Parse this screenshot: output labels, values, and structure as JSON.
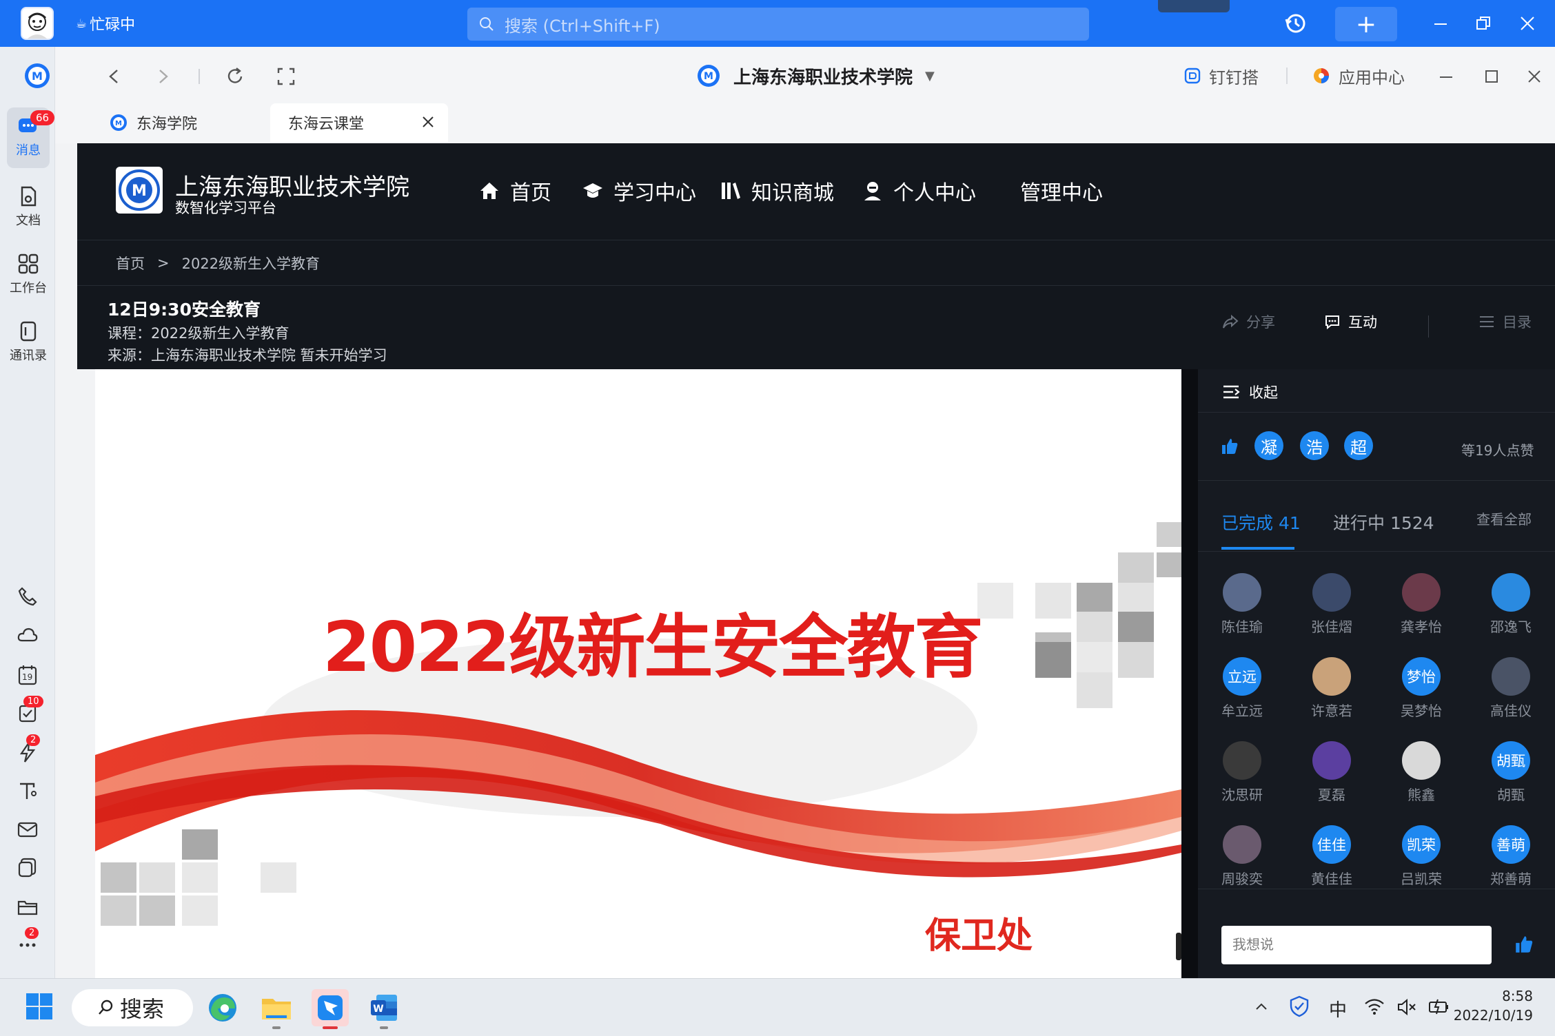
{
  "titlebar": {
    "status": "忙碌中",
    "search_placeholder": "搜索 (Ctrl+Shift+F)",
    "plus_label": "+"
  },
  "rail": {
    "items": [
      {
        "label": "消息",
        "badge": "66",
        "icon": "chat-icon"
      },
      {
        "label": "文档",
        "icon": "document-icon"
      },
      {
        "label": "工作台",
        "icon": "grid-icon"
      },
      {
        "label": "通讯录",
        "icon": "contacts-icon"
      }
    ],
    "small_icons": [
      {
        "icon": "phone-icon"
      },
      {
        "icon": "cloud-icon"
      },
      {
        "icon": "calendar-icon",
        "text": "19"
      },
      {
        "icon": "todo-icon",
        "badge": "10"
      },
      {
        "icon": "flash-icon",
        "badge": "2"
      },
      {
        "icon": "text-tool-icon"
      },
      {
        "icon": "mail-icon"
      },
      {
        "icon": "notes-icon"
      },
      {
        "icon": "folder-icon"
      },
      {
        "icon": "more-icon",
        "badge": "2"
      }
    ]
  },
  "chrome": {
    "site_title": "上海东海职业技术学院",
    "dingda": "钉钉搭",
    "app_center": "应用中心",
    "tabs": [
      {
        "label": "东海学院"
      },
      {
        "label": "东海云课堂"
      }
    ]
  },
  "site": {
    "brand_name": "上海东海职业技术学院",
    "brand_sub": "数智化学习平台",
    "nav": [
      {
        "label": "首页",
        "icon": "home-icon"
      },
      {
        "label": "学习中心",
        "icon": "graduation-cap-icon"
      },
      {
        "label": "知识商城",
        "icon": "library-icon"
      },
      {
        "label": "个人中心",
        "icon": "user-icon"
      },
      {
        "label": "管理中心",
        "icon": ""
      }
    ],
    "breadcrumb": {
      "home": "首页",
      "sep": ">",
      "current": "2022级新生入学教育"
    }
  },
  "lesson": {
    "title": "12日9:30安全教育",
    "course": "课程：2022级新生入学教育",
    "source": "来源：上海东海职业技术学院 暂未开始学习",
    "actions": {
      "share": "分享",
      "interact": "互动",
      "toc": "目录"
    }
  },
  "slide": {
    "title": "2022级新生安全教育",
    "dept": "保卫处"
  },
  "panel": {
    "collapse": "收起",
    "likers": [
      "凝",
      "浩",
      "超"
    ],
    "likes_count": "等19人点赞",
    "tab_done": "已完成 41",
    "tab_progress": "进行中 1524",
    "view_all": "查看全部",
    "students": [
      {
        "name": "陈佳瑜",
        "color": "#5a6a8c",
        "text": ""
      },
      {
        "name": "张佳熠",
        "color": "#3b4a6a",
        "text": ""
      },
      {
        "name": "龚孝怡",
        "color": "#6b3a4a",
        "text": ""
      },
      {
        "name": "邵逸飞",
        "color": "#2a8ae0",
        "text": ""
      },
      {
        "name": "牟立远",
        "color": "#1e88f0",
        "text": "立远"
      },
      {
        "name": "许意若",
        "color": "#c9a27a",
        "text": ""
      },
      {
        "name": "吴梦怡",
        "color": "#1e88f0",
        "text": "梦怡"
      },
      {
        "name": "高佳仪",
        "color": "#4a5366",
        "text": ""
      },
      {
        "name": "沈思研",
        "color": "#3a3a3a",
        "text": ""
      },
      {
        "name": "夏磊",
        "color": "#5b3fa0",
        "text": ""
      },
      {
        "name": "熊鑫",
        "color": "#d9d9d9",
        "text": ""
      },
      {
        "name": "胡甄",
        "color": "#1e88f0",
        "text": "胡甄"
      },
      {
        "name": "周骏奕",
        "color": "#6a5a6e",
        "text": ""
      },
      {
        "name": "黄佳佳",
        "color": "#1e88f0",
        "text": "佳佳"
      },
      {
        "name": "吕凯荣",
        "color": "#1e88f0",
        "text": "凯荣"
      },
      {
        "name": "郑善萌",
        "color": "#1e88f0",
        "text": "善萌"
      }
    ],
    "say_placeholder": "我想说"
  },
  "taskbar": {
    "search": "搜索",
    "ime": "中",
    "time": "8:58",
    "date": "2022/10/19"
  },
  "colors": {
    "titlebar": "#1b72f5",
    "accent": "#1e88f0",
    "dark_bg": "#13171d",
    "slide_red": "#e21e1b"
  }
}
